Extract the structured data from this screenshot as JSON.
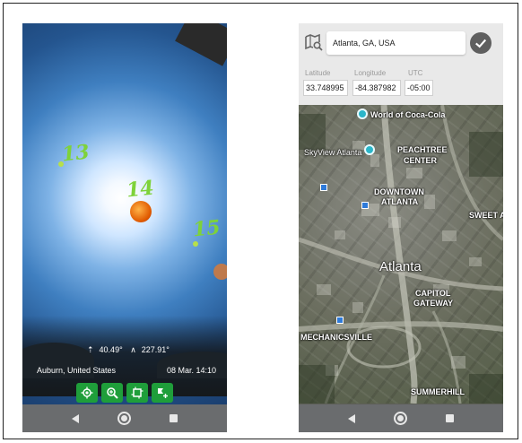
{
  "left_screen": {
    "hour_labels": [
      "13",
      "14",
      "15"
    ],
    "elevation": "40.49°",
    "azimuth": "227.91°",
    "location": "Auburn, United States",
    "datetime": "08 Mar. 14:10",
    "tools": [
      "locate-icon",
      "zoom-icon",
      "frame-icon",
      "add-marker-icon"
    ],
    "tool_color": "#1f9e3a"
  },
  "right_screen": {
    "search": {
      "value": "Atlanta, GA, USA"
    },
    "latitude": {
      "label": "Latitude",
      "value": "33.748995"
    },
    "longitude": {
      "label": "Longitude",
      "value": "-84.387982"
    },
    "utc": {
      "label": "UTC",
      "value": "-05:00"
    },
    "map_labels": {
      "world_of_coca_cola": "World of Coca-Cola",
      "skyview": "SkyView Atlanta",
      "peachtree": "PEACHTREE",
      "center": "CENTER",
      "downtown": "DOWNTOWN",
      "atlanta_small": "ATLANTA",
      "sweet_auburn": "SWEET AU",
      "atlanta": "Atlanta",
      "capitol": "CAPITOL",
      "gateway": "GATEWAY",
      "mechanicsville": "MECHANICSVILLE",
      "summerhill": "SUMMERHILL"
    }
  },
  "navbar": {
    "icons": [
      "back-icon",
      "home-icon",
      "recents-icon"
    ]
  }
}
